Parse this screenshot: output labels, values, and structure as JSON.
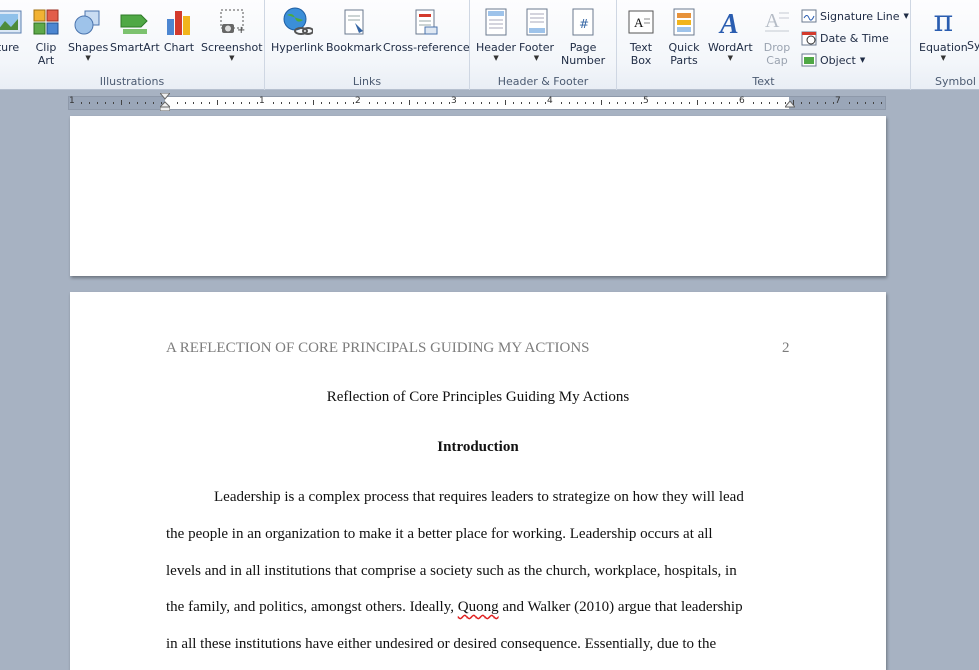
{
  "ribbon": {
    "illustrations": {
      "label": "Illustrations",
      "picture_label": "ture",
      "clip_art_line1": "Clip",
      "clip_art_line2": "Art",
      "shapes_label": "Shapes",
      "smartart_label": "SmartArt",
      "chart_label": "Chart",
      "screenshot_label": "Screenshot"
    },
    "links": {
      "label": "Links",
      "hyperlink_label": "Hyperlink",
      "bookmark_label": "Bookmark",
      "crossref_label": "Cross-reference"
    },
    "header_footer": {
      "label": "Header & Footer",
      "header_label": "Header",
      "footer_label": "Footer",
      "page_number_line1": "Page",
      "page_number_line2": "Number"
    },
    "text": {
      "label": "Text",
      "textbox_line1": "Text",
      "textbox_line2": "Box",
      "quickparts_line1": "Quick",
      "quickparts_line2": "Parts",
      "wordart_label": "WordArt",
      "dropcap_line1": "Drop",
      "dropcap_line2": "Cap",
      "signature_line_label": "Signature Line",
      "date_time_label": "Date & Time",
      "object_label": "Object"
    },
    "symbols": {
      "label": "Symbol",
      "equation_label": "Equation",
      "symbol_label": "Sy",
      "pi_glyph": "π"
    },
    "colors": {
      "accent": "#2a5db0",
      "chart_red": "#d33a2c",
      "chart_yellow": "#f1b41c"
    }
  },
  "ruler": {
    "numbers": [
      "1",
      "1",
      "2",
      "3",
      "4",
      "5",
      "6",
      "7"
    ]
  },
  "document": {
    "header_text": "A REFLECTION OF CORE PRINCIPALS GUIDING MY ACTIONS",
    "page_number": "2",
    "title": "Reflection of Core Principles Guiding My Actions",
    "heading": "Introduction",
    "lines": [
      "Leadership is a complex process that requires leaders to strategize on how they will lead",
      "the people in an organization to make it a better place for working. Leadership occurs at all",
      "levels and in all institutions that comprise  a society such as the church, workplace, hospitals, in",
      "the family, and politics,  amongst others. Ideally, ",
      "in all these institutions have either undesired or  desired consequence.  Essentially,  due to the"
    ],
    "line4_misspelled": "Quong",
    "line4_rest": " and Walker (2010) argue that leadership"
  }
}
